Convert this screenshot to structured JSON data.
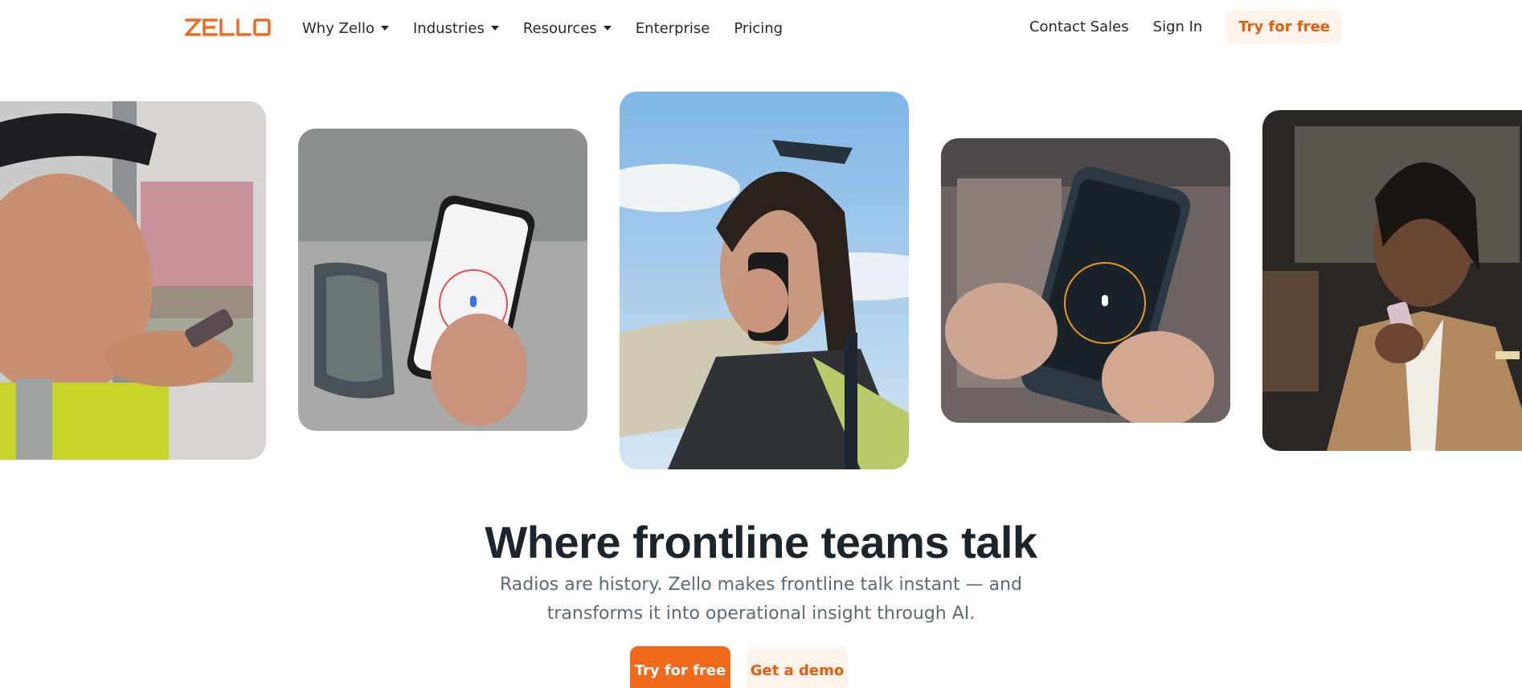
{
  "brand": {
    "logo_text": "ZELLO",
    "accent": "#f06a1d",
    "accent_dark": "#e45c0d",
    "accent_soft": "#fff3ea"
  },
  "nav": {
    "why": "Why Zello",
    "industries": "Industries",
    "resources": "Resources",
    "enterprise": "Enterprise",
    "pricing": "Pricing",
    "contact": "Contact Sales",
    "signin": "Sign In",
    "try": "Try for free"
  },
  "hero": {
    "title": "Where frontline teams talk",
    "subtitle": "Radios are history. Zello makes frontline talk instant — and transforms it into operational insight through AI.",
    "cta_primary": "Try for free",
    "cta_secondary": "Get a demo"
  },
  "gallery": {
    "cards": [
      {
        "name": "driver-photo"
      },
      {
        "name": "phone-in-car-photo"
      },
      {
        "name": "worker-radio-photo"
      },
      {
        "name": "rugged-phone-photo"
      },
      {
        "name": "hotel-staff-photo"
      }
    ]
  }
}
